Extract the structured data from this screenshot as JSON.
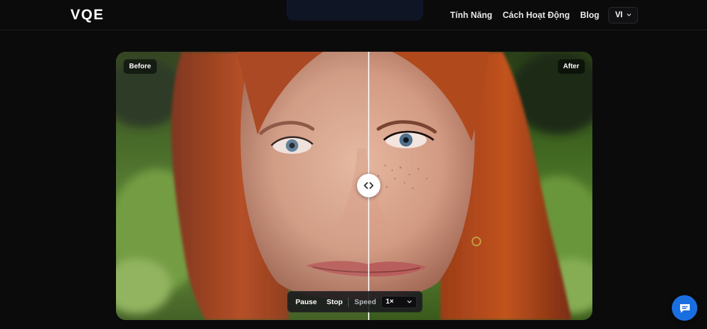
{
  "header": {
    "logo": "VQE",
    "nav": [
      {
        "label": "Tính Năng"
      },
      {
        "label": "Cách Hoạt Động"
      },
      {
        "label": "Blog"
      }
    ],
    "language": "VI"
  },
  "comparison": {
    "before_label": "Before",
    "after_label": "After",
    "slider_position_percent": 53
  },
  "player": {
    "pause_label": "Pause",
    "stop_label": "Stop",
    "speed_label": "Speed",
    "speed_value": "1×"
  },
  "colors": {
    "background": "#0b0b0c",
    "chat_button": "#1a6fe0",
    "hair": "#b3461c",
    "foliage": "#4d7a25"
  },
  "icons": {
    "handle": "chevrons-left-right-icon",
    "chat": "chat-bubble-icon",
    "language_dropdown": "chevron-down-icon",
    "speed_dropdown": "chevron-down-icon"
  }
}
